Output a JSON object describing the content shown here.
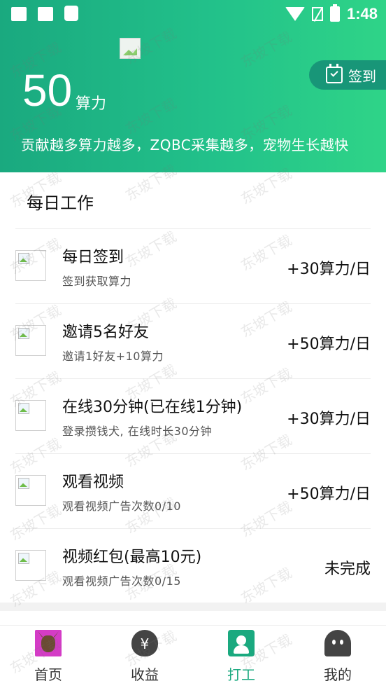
{
  "status_bar": {
    "time": "1:48"
  },
  "header": {
    "power_value": "50",
    "power_unit": "算力",
    "description": "贡献越多算力越多，ZQBC采集越多，宠物生长越快",
    "signin_label": "签到",
    "colors": {
      "gradient_start": "#1aa97f",
      "gradient_end": "#2fd488",
      "signin_bg": "#189678"
    }
  },
  "section": {
    "title": "每日工作"
  },
  "tasks": [
    {
      "title": "每日签到",
      "subtitle": "签到获取算力",
      "reward": "+30算力/日"
    },
    {
      "title": "邀请5名好友",
      "subtitle": "邀请1好友+10算力",
      "reward": "+50算力/日"
    },
    {
      "title": "在线30分钟(已在线1分钟)",
      "subtitle": "登录攒钱犬, 在线时长30分钟",
      "reward": "+30算力/日"
    },
    {
      "title": "观看视频",
      "subtitle": "观看视频广告次数0/10",
      "reward": "+50算力/日"
    },
    {
      "title": "视频红包(最高10元)",
      "subtitle": "观看视频广告次数0/15",
      "reward": "未完成"
    }
  ],
  "tabs": [
    {
      "label": "首页",
      "icon": "dog-avatar-icon",
      "active": false
    },
    {
      "label": "收益",
      "icon": "money-bag-icon",
      "active": false
    },
    {
      "label": "打工",
      "icon": "worker-icon",
      "active": true
    },
    {
      "label": "我的",
      "icon": "ghost-profile-icon",
      "active": false
    }
  ],
  "watermark": "东坡下载",
  "accent_color": "#1aa97f"
}
